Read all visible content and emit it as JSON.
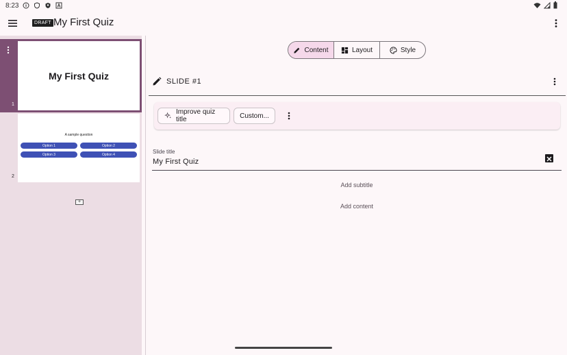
{
  "status_bar": {
    "time": "8:23",
    "left_icons": [
      "info-circle-icon",
      "shield-outline-icon",
      "shield-filled-icon",
      "a-square-icon"
    ],
    "right_icons": [
      "wifi-icon",
      "cell-signal-icon",
      "battery-icon"
    ]
  },
  "app_bar": {
    "draft_badge": "DRAFT",
    "title": "My First Quiz"
  },
  "slides_panel": {
    "slides": [
      {
        "number": "1",
        "title": "My First Quiz",
        "selected": true
      },
      {
        "number": "2",
        "question": "A sample question",
        "options": [
          "Option 1",
          "Option 2",
          "Option 3",
          "Option 4"
        ],
        "selected": false
      }
    ],
    "add_slide_symbol": "+"
  },
  "tabs": {
    "items": [
      {
        "label": "Content",
        "icon": "pencil-icon",
        "active": true
      },
      {
        "label": "Layout",
        "icon": "layout-grid-icon",
        "active": false
      },
      {
        "label": "Style",
        "icon": "palette-icon",
        "active": false
      }
    ]
  },
  "editor": {
    "slide_heading": "SLIDE #1",
    "suggestions": {
      "improve_label": "Improve quiz title",
      "custom_label": "Custom..."
    },
    "title_field": {
      "label": "Slide title",
      "value": "My First Quiz"
    },
    "add_subtitle": "Add subtitle",
    "add_content": "Add content"
  },
  "colors": {
    "accent": "#7d4f73",
    "active_tab": "#f5d8ea",
    "option_blue": "#3f51b5",
    "panel_bg": "#ecdde4"
  }
}
